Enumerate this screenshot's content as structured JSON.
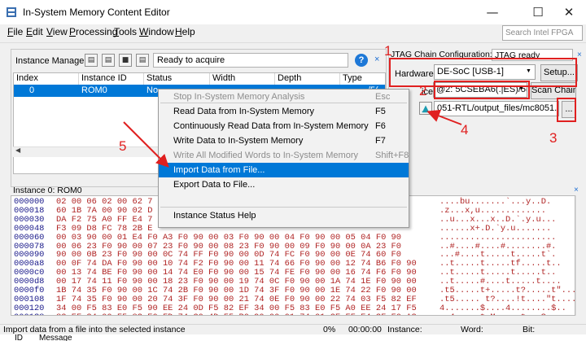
{
  "window": {
    "title": "In-System Memory Content Editor",
    "minimize": "—",
    "maximize": "☐",
    "close": "✕"
  },
  "menubar": {
    "items": [
      {
        "underline": "F",
        "rest": "ile"
      },
      {
        "underline": "E",
        "rest": "dit"
      },
      {
        "underline": "V",
        "rest": "iew"
      },
      {
        "underline": "P",
        "rest": "rocessing"
      },
      {
        "underline": "T",
        "rest": "ools"
      },
      {
        "underline": "W",
        "rest": "indow"
      },
      {
        "underline": "H",
        "rest": "elp"
      }
    ],
    "search_placeholder": "Search Intel FPGA"
  },
  "instance_manager": {
    "label": "Instance Manager:",
    "status": "Ready to acquire",
    "help": "?",
    "close": "×",
    "columns": [
      "Index",
      "Instance ID",
      "Status",
      "Width",
      "Depth",
      "Type"
    ],
    "row": {
      "index": "0",
      "instance_id": "ROM0",
      "status": "No",
      "type": "/5("
    }
  },
  "jtag": {
    "label": "JTAG Chain Configuration:",
    "status": "JTAG ready",
    "close": "×",
    "hardware_label": "Hardware:",
    "hardware_value": "DE-SoC [USB-1]",
    "setup_label": "Setup...",
    "device_label": "ice:",
    "device_value": "@2: 5CSEBA6(.|ES)/5(",
    "scan_label": "Scan Chain",
    "sof_path": "051-RTL/output_files/mc8051.sof",
    "browse_label": "..."
  },
  "annotations": {
    "n1": "1",
    "n2": "2",
    "n3": "3",
    "n4": "4",
    "n5": "5",
    "color": "#e02020"
  },
  "hex": {
    "title": "Instance 0: ROM0",
    "close": "×",
    "rows": [
      {
        "addr": "000000",
        "bytes": "02 00 06 02 00 62 7",
        "ascii": "....bu.......`...y..D."
      },
      {
        "addr": "000018",
        "bytes": "60 1B 7A 00 90 02 D",
        "ascii": ".z...x,u............."
      },
      {
        "addr": "000030",
        "bytes": "DA F2 75 A0 FF E4 7",
        "ascii": "..u...x...x..D.`.y.u..."
      },
      {
        "addr": "000048",
        "bytes": "F3 09 D8 FC 78 2B E",
        "ascii": "......x+.D.`y.u......."
      },
      {
        "addr": "000060",
        "bytes": "00 03 90 00 01 E4 F0 A3 F0 90 00 03 F0 90 00 04 F0 90 00 05 04 F0 90",
        "ascii": "......................."
      },
      {
        "addr": "000078",
        "bytes": "00 06 23 F0 90 00 07 23 F0 90 00 08 23 F0 90 00 09 F0 90 00 0A 23 F0",
        "ascii": "..#....#....#........#."
      },
      {
        "addr": "000090",
        "bytes": "90 00 0B 23 F0 90 00 0C 74 FF F0 90 00 0D 74 FC F0 90 00 0E 74 60 F0",
        "ascii": "...#....t.....t.....t`."
      },
      {
        "addr": "0000a8",
        "bytes": "00 0F 74 DA F0 90 00 10 74 F2 F0 90 00 11 74 66 F0 90 00 12 74 B6 F0 90",
        "ascii": "..t.....t.....tf.....t.."
      },
      {
        "addr": "0000c0",
        "bytes": "00 13 74 BE F0 90 00 14 74 E0 F0 90 00 15 74 FE F0 90 00 16 74 F6 F0 90",
        "ascii": "..t.....t.....t.....t.."
      },
      {
        "addr": "0000d8",
        "bytes": "00 17 74 11 F0 90 00 18 23 F0 90 00 19 74 0C F0 90 00 1A 74 1E F0 90 00",
        "ascii": "..t.....#....t.....t...."
      },
      {
        "addr": "0000f0",
        "bytes": "1B 74 35 F0 90 00 1C 74 2B F0 90 00 1D 74 3F F0 90 00 1E 74 22 F0 90 00",
        "ascii": ".t5.....t+.....t?.....t\"..."
      },
      {
        "addr": "000108",
        "bytes": "1F 74 35 F0 90 00 20 74 3F F0 90 00 21 74 0E F0 90 00 22 74 03 F5 82 EF",
        "ascii": ".t5..... t?....!t....\"t...."
      },
      {
        "addr": "000120",
        "bytes": "34 00 F5 83 E0 F5 90 EE 24 0D F5 82 EF 34 00 F5 83 E0 F5 A0 EE 24 17 F5",
        "ascii": "4.......$....4........$.."
      },
      {
        "addr": "000138",
        "bytes": "82 EF 34 00 F5 83 E0 FD 74 C0 4D F5 B0 90 00 01 74 01 2E FF E4 3F F0 A3",
        "ascii": "..4.....t.M.....t...?.."
      },
      {
        "addr": "000150",
        "bytes": "90 00 01 E0 FE A3 E0 FF 90 00 23 74 0A F0 E4 A3 F0 8E 82 8F 83 12 01 B8",
        "ascii": "..........#t..........."
      }
    ]
  },
  "context_menu": {
    "items": [
      {
        "label": "Stop In-System Memory Analysis",
        "shortcut": "Esc",
        "disabled": true
      },
      {
        "label": "Read Data from In-System Memory",
        "shortcut": "F5",
        "disabled": false
      },
      {
        "label": "Continuously Read Data from In-System Memory",
        "shortcut": "F6",
        "disabled": false
      },
      {
        "label": "Write Data to In-System Memory",
        "shortcut": "F7",
        "disabled": false
      },
      {
        "label": "Write All Modified Words to In-System Memory",
        "shortcut": "Shift+F8",
        "disabled": true
      },
      {
        "label": "Import Data from File...",
        "shortcut": "",
        "disabled": false,
        "selected": true
      },
      {
        "label": "Export Data to File...",
        "shortcut": "",
        "disabled": false
      },
      {
        "label": "Instance Status Help",
        "shortcut": "",
        "disabled": false
      }
    ]
  },
  "statusbar": {
    "message": "Import data from a file into the selected instance",
    "percent": "0%",
    "time": "00:00:00",
    "instance_label": "Instance:",
    "word_label": "Word:",
    "bit_label": "Bit:"
  },
  "messages": {
    "id_header": "ID",
    "message_header": "Message"
  },
  "colors": {
    "selection": "#0078d7",
    "hex_data": "#b02424",
    "annotation": "#e02020"
  }
}
